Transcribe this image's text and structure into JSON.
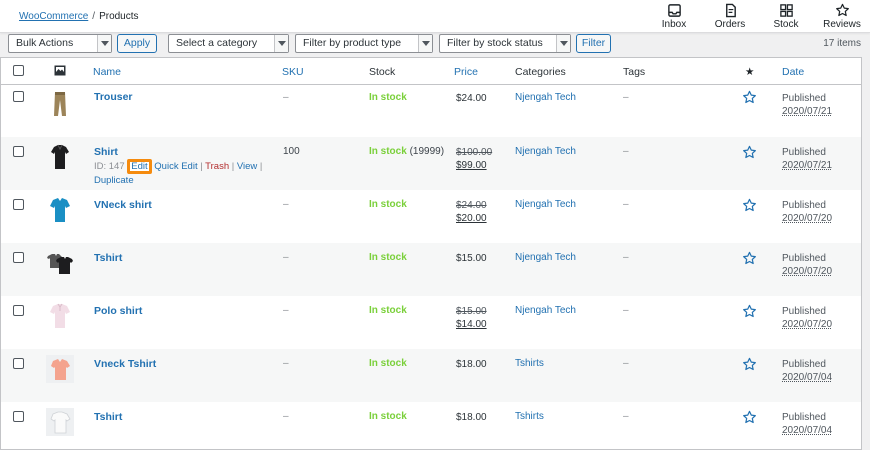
{
  "breadcrumb": {
    "root": "WooCommerce",
    "separator": "/",
    "current": "Products"
  },
  "topnav": [
    {
      "label": "Inbox",
      "icon": "inbox-icon"
    },
    {
      "label": "Orders",
      "icon": "orders-icon"
    },
    {
      "label": "Stock",
      "icon": "stock-icon"
    },
    {
      "label": "Reviews",
      "icon": "reviews-icon"
    }
  ],
  "tablenav": {
    "bulk_actions": "Bulk Actions",
    "apply": "Apply",
    "category_filter": "Select a category",
    "type_filter": "Filter by product type",
    "stock_filter": "Filter by stock status",
    "filter": "Filter",
    "count": "17 items"
  },
  "columns": {
    "name": "Name",
    "sku": "SKU",
    "stock": "Stock",
    "price": "Price",
    "categories": "Categories",
    "tags": "Tags",
    "featured": "★",
    "date": "Date"
  },
  "rows": [
    {
      "name": "Trouser",
      "sku": "–",
      "stock": "In stock",
      "stock_qty": "",
      "regular_price": "",
      "price": "$24.00",
      "category": "Njengah Tech",
      "tags": "–",
      "status": "Published",
      "date": "2020/07/21",
      "thumb": "trouser"
    },
    {
      "name": "Shirt",
      "sku": "100",
      "stock": "In stock",
      "stock_qty": "(19999)",
      "regular_price": "$100.00",
      "price": "$99.00",
      "category": "Njengah Tech",
      "tags": "–",
      "status": "Published",
      "date": "2020/07/21",
      "thumb": "shirt"
    },
    {
      "name": "VNeck shirt",
      "sku": "–",
      "stock": "In stock",
      "stock_qty": "",
      "regular_price": "$24.00",
      "price": "$20.00",
      "category": "Njengah Tech",
      "tags": "–",
      "status": "Published",
      "date": "2020/07/20",
      "thumb": "vneck"
    },
    {
      "name": "Tshirt",
      "sku": "–",
      "stock": "In stock",
      "stock_qty": "",
      "regular_price": "",
      "price": "$15.00",
      "category": "Njengah Tech",
      "tags": "–",
      "status": "Published",
      "date": "2020/07/20",
      "thumb": "tshirt"
    },
    {
      "name": "Polo shirt",
      "sku": "–",
      "stock": "In stock",
      "stock_qty": "",
      "regular_price": "$15.00",
      "price": "$14.00",
      "category": "Njengah Tech",
      "tags": "–",
      "status": "Published",
      "date": "2020/07/20",
      "thumb": "polo"
    },
    {
      "name": "Vneck Tshirt",
      "sku": "–",
      "stock": "In stock",
      "stock_qty": "",
      "regular_price": "",
      "price": "$18.00",
      "category": "Tshirts",
      "tags": "–",
      "status": "Published",
      "date": "2020/07/04",
      "thumb": "vneck-tshirt"
    },
    {
      "name": "Tshirt",
      "sku": "–",
      "stock": "In stock",
      "stock_qty": "",
      "regular_price": "",
      "price": "$18.00",
      "category": "Tshirts",
      "tags": "–",
      "status": "Published",
      "date": "2020/07/04",
      "thumb": "tshirt-white"
    }
  ],
  "row_actions": {
    "id_text": "ID: 147",
    "edit": "Edit",
    "quick_edit": "Quick Edit",
    "trash": "Trash",
    "view": "View",
    "duplicate": "Duplicate",
    "sep": "|"
  },
  "colors": {
    "accent": "#2271b1",
    "in_stock": "#7ad03a",
    "highlight": "#f58b0e",
    "trash": "#b32d2e"
  }
}
